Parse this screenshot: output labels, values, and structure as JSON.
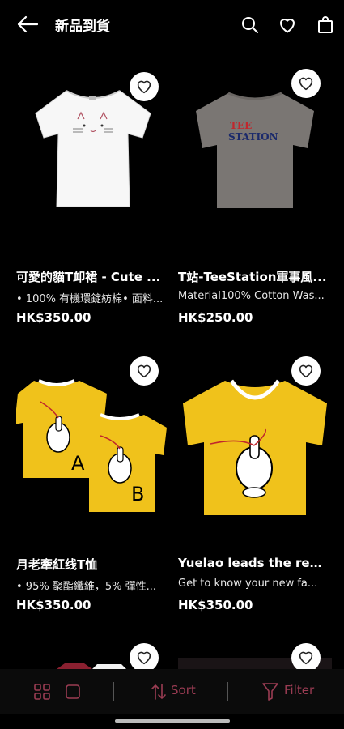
{
  "header": {
    "title": "新品到貨"
  },
  "products": [
    {
      "name": "可愛的貓T卹裙 - Cute ...",
      "desc": "• 100% 有機環錠紡棉• 面料...",
      "price": "HK$350.00"
    },
    {
      "name": "T站-TeeStation軍事風...",
      "desc": "Material100% Cotton Was...",
      "price": "HK$250.00",
      "print_line1": "TEE",
      "print_line2": "STATION"
    },
    {
      "name": "月老牽紅线T恤",
      "desc": "• 95% 聚酯纖維，5% 彈性...",
      "price": "HK$350.00",
      "letter_a": "A",
      "letter_b": "B"
    },
    {
      "name": "Yuelao leads the red...",
      "desc": "Get to know your new fa...",
      "price": "HK$350.00"
    }
  ],
  "bottom_bar": {
    "sort_label": "Sort",
    "filter_label": "Filter"
  },
  "colors": {
    "background": "#000000",
    "accent": "#9b3c53",
    "shirt_yellow": "#f0c21b",
    "shirt_grey": "#7a7673"
  }
}
